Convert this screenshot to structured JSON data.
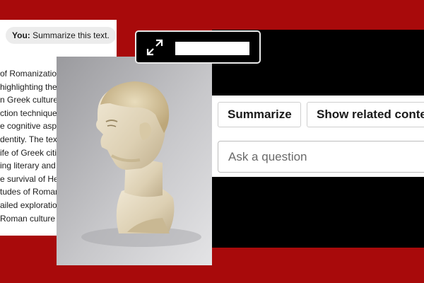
{
  "chat": {
    "speaker": "You:",
    "message": "Summarize this text."
  },
  "document": {
    "lines": [
      "of Romanization",
      "highlighting the",
      "n Greek culture",
      "ction techniques",
      "e cognitive aspe",
      "dentity. The text",
      "ife of Greek citi",
      "ing literary and",
      "e survival of Hel",
      "tudes of Roman",
      "ailed exploration",
      "Roman culture"
    ]
  },
  "actions": {
    "summarize_label": "Summarize",
    "related_label": "Show related conte"
  },
  "ask": {
    "placeholder": "Ask a question"
  },
  "toolbar": {
    "icon": "expand-icon"
  },
  "colors": {
    "background": "#a80a0b",
    "panel": "#000000",
    "card": "#ffffff"
  }
}
